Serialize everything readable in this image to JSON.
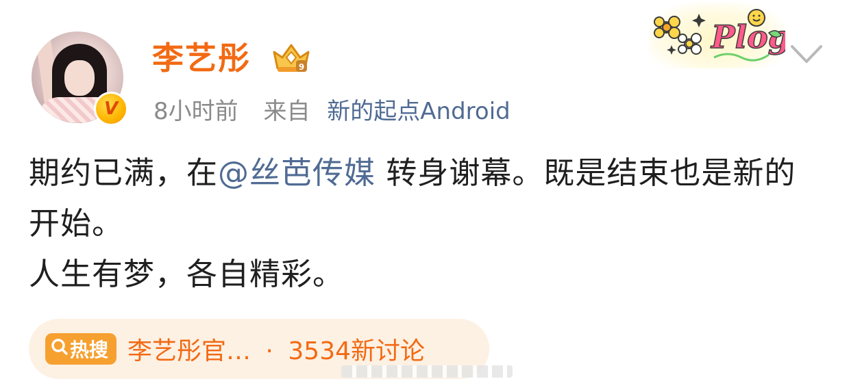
{
  "post": {
    "author": {
      "name": "李艺彤",
      "avatar_icon": "avatar-photo",
      "verified_badge_icon": "verified-v-icon",
      "member_badge_icon": "crown-member-icon"
    },
    "meta": {
      "time": "8小时前",
      "source_prefix": "来自",
      "client": "新的起点Android"
    },
    "content": {
      "line1_before": "期约已满，在",
      "mention": "@丝芭传媒",
      "line1_after": " 转身谢幕。既是结束也是新的开始。",
      "line2": "人生有梦，各自精彩。"
    },
    "decoration_icon": "plog-sticker-icon",
    "menu_icon": "chevron-down-icon",
    "hot_search": {
      "badge_icon": "search-icon",
      "badge_label": "热搜",
      "topic": "李艺彤官…",
      "separator": "·",
      "count_text": "3534新讨论"
    }
  },
  "colors": {
    "brand_orange": "#f26a13",
    "link_blue": "#506b93",
    "meta_gray": "#8a8a8a",
    "hot_bg": "#fdf1e4",
    "hot_badge": "#f6a030"
  }
}
